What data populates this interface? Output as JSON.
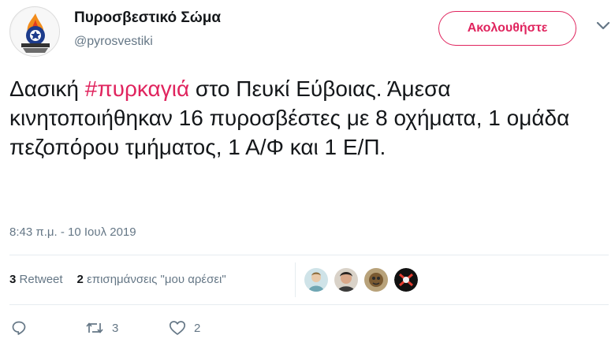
{
  "header": {
    "display_name": "Πυροσβεστικό Σώμα",
    "handle": "@pyrosvestiki",
    "follow_label": "Ακολουθήστε",
    "avatar_icon": "fire-service-logo-icon",
    "menu_icon": "chevron-down-icon"
  },
  "tweet": {
    "text_before": "Δασική ",
    "hashtag": "#πυρκαγιά",
    "text_after": " στο Πευκί Εύβοιας. Άμεσα κινητοποιήθηκαν 16 πυροσβέστες με 8 οχήματα, 1 ομάδα πεζοπόρου τμήματος, 1 Α/Φ και 1 Ε/Π."
  },
  "timestamp": "8:43 π.μ. - 10 Ιουλ 2019",
  "stats": {
    "retweets_count": "3",
    "retweets_label": "Retweet",
    "likes_count": "2",
    "likes_label": "επισημάνσεις \"μου αρέσει\""
  },
  "actions": {
    "reply_icon": "reply-icon",
    "retweet_icon": "retweet-icon",
    "retweet_count": "3",
    "like_icon": "heart-icon",
    "like_count": "2"
  },
  "colors": {
    "accent": "#e0245e",
    "text": "#14171a",
    "muted": "#657786",
    "divider": "#e6ecf0"
  }
}
